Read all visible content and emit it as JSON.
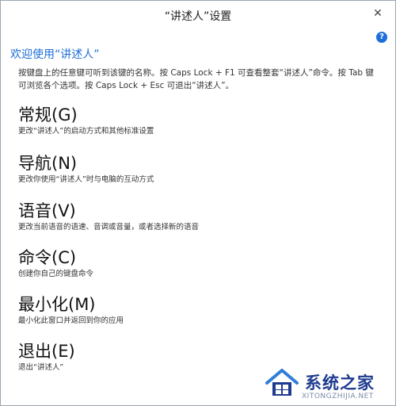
{
  "window": {
    "title": "“讲述人”设置",
    "close_label": "✕"
  },
  "help": {
    "icon": "question-circle-icon",
    "label": "?"
  },
  "welcome": {
    "heading": "欢迎使用“讲述人”",
    "intro": "按键盘上的任意键可听到该键的名称。按 Caps Lock + F1 可查看整套“讲述人”命令。按 Tab 键可浏览各个选项。按 Caps Lock + Esc 可退出“讲述人”。"
  },
  "sections": [
    {
      "title": "常规(G)",
      "desc": "更改“讲述人”的启动方式和其他标准设置"
    },
    {
      "title": "导航(N)",
      "desc": "更改你使用“讲述人”时与电脑的互动方式"
    },
    {
      "title": "语音(V)",
      "desc": "更改当前语音的语速、音调或音量，或者选择新的语音"
    },
    {
      "title": "命令(C)",
      "desc": "创建你自己的键盘命令"
    },
    {
      "title": "最小化(M)",
      "desc": "最小化此窗口并返回到你的应用"
    },
    {
      "title": "退出(E)",
      "desc": "退出“讲述人”"
    }
  ],
  "watermark": {
    "title": "系统之家",
    "url": "XITONGZHIJIA.NET",
    "colors": {
      "primary": "#1f3b8f",
      "accent": "#2f7fd8"
    }
  },
  "colors": {
    "accent": "#1e6fd9",
    "background": "#ffffff",
    "text": "#111111"
  }
}
